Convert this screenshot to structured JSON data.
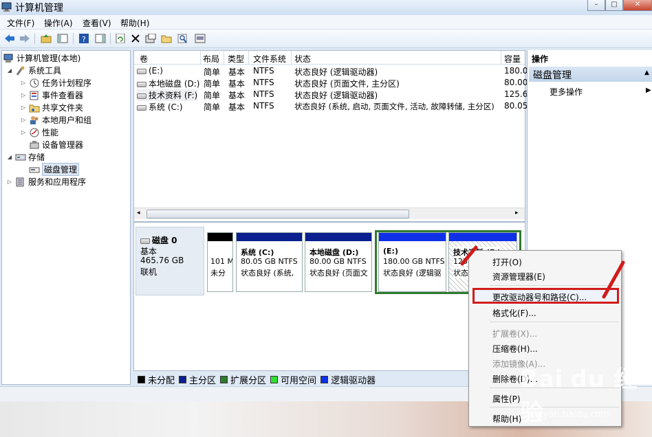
{
  "window": {
    "title": "计算机管理",
    "controls": [
      "–",
      "□",
      "✕"
    ]
  },
  "menubar": [
    "文件(F)",
    "操作(A)",
    "查看(V)",
    "帮助(H)"
  ],
  "tree": [
    {
      "label": "计算机管理(本地)",
      "level": 0,
      "expander": "",
      "icon": "computer-management-icon"
    },
    {
      "label": "系统工具",
      "level": 1,
      "expander": "◢",
      "icon": "tools-icon"
    },
    {
      "label": "任务计划程序",
      "level": 2,
      "expander": "▷",
      "icon": "clock-icon"
    },
    {
      "label": "事件查看器",
      "level": 2,
      "expander": "▷",
      "icon": "event-viewer-icon"
    },
    {
      "label": "共享文件夹",
      "level": 2,
      "expander": "▷",
      "icon": "shared-folder-icon"
    },
    {
      "label": "本地用户和组",
      "level": 2,
      "expander": "▷",
      "icon": "users-icon"
    },
    {
      "label": "性能",
      "level": 2,
      "expander": "▷",
      "icon": "performance-icon"
    },
    {
      "label": "设备管理器",
      "level": 2,
      "expander": "",
      "icon": "device-manager-icon"
    },
    {
      "label": "存储",
      "level": 1,
      "expander": "◢",
      "icon": "storage-icon"
    },
    {
      "label": "磁盘管理",
      "level": 2,
      "expander": "",
      "icon": "disk-management-icon",
      "selected": true
    },
    {
      "label": "服务和应用程序",
      "level": 1,
      "expander": "▷",
      "icon": "services-icon"
    }
  ],
  "volume_table": {
    "headers": [
      "卷",
      "布局",
      "类型",
      "文件系统",
      "状态",
      "容量"
    ],
    "rows": [
      [
        "(E:)",
        "简单",
        "基本",
        "NTFS",
        "状态良好 (逻辑驱动器)",
        "180.0"
      ],
      [
        "本地磁盘 (D:)",
        "简单",
        "基本",
        "NTFS",
        "状态良好 (页面文件, 主分区)",
        "80.00"
      ],
      [
        "技术资料 (F:)",
        "简单",
        "基本",
        "NTFS",
        "状态良好 (逻辑驱动器)",
        "125.6"
      ],
      [
        "系统 (C:)",
        "简单",
        "基本",
        "NTFS",
        "状态良好 (系统, 启动, 页面文件, 活动, 故障转储, 主分区)",
        "80.05"
      ]
    ]
  },
  "disk": {
    "name": "磁盘 0",
    "type": "基本",
    "size": "465.76 GB",
    "status": "联机",
    "partitions": [
      {
        "name": "",
        "line1": "101 M",
        "line2": "未分",
        "bar": "#000000"
      },
      {
        "name": "系统 (C:)",
        "line1": "80.05 GB NTFS",
        "line2": "状态良好 (系统,",
        "bar": "#0b1f8f"
      },
      {
        "name": "本地磁盘 (D:)",
        "line1": "80.00 GB NTFS",
        "line2": "状态良好 (页面文",
        "bar": "#0b1f8f"
      },
      {
        "name": "(E:)",
        "line1": "180.00 GB NTFS",
        "line2": "状态良好 (逻辑驱",
        "bar": "#1030e8"
      },
      {
        "name": "技术资料 (F:)",
        "line1": "125",
        "line2": "状态",
        "bar": "#1030e8"
      }
    ]
  },
  "legend": [
    {
      "label": "未分配",
      "color": "#000000"
    },
    {
      "label": "主分区",
      "color": "#0b1f8f"
    },
    {
      "label": "扩展分区",
      "color": "#2e7b2e"
    },
    {
      "label": "可用空间",
      "color": "#33dd33"
    },
    {
      "label": "逻辑驱动器",
      "color": "#1030e8"
    }
  ],
  "actions": {
    "header": "操作",
    "section": "磁盘管理",
    "more": "更多操作"
  },
  "context_menu": {
    "items": [
      {
        "label": "打开(O)",
        "disabled": false
      },
      {
        "label": "资源管理器(E)",
        "disabled": false
      },
      {
        "label": "更改驱动器号和路径(C)...",
        "disabled": false,
        "highlighted": true
      },
      {
        "label": "格式化(F)...",
        "disabled": false
      },
      {
        "label": "扩展卷(X)...",
        "disabled": true
      },
      {
        "label": "压缩卷(H)...",
        "disabled": false
      },
      {
        "label": "添加镜像(A)...",
        "disabled": true
      },
      {
        "label": "删除卷(D)...",
        "disabled": false
      },
      {
        "label": "属性(P)",
        "disabled": false
      },
      {
        "label": "帮助(H)",
        "disabled": false
      }
    ]
  },
  "watermark": {
    "logo": "Bai du 经验",
    "url": "jingyan.baidu.com"
  },
  "colors": {
    "annotation_red": "#d21a1a"
  }
}
